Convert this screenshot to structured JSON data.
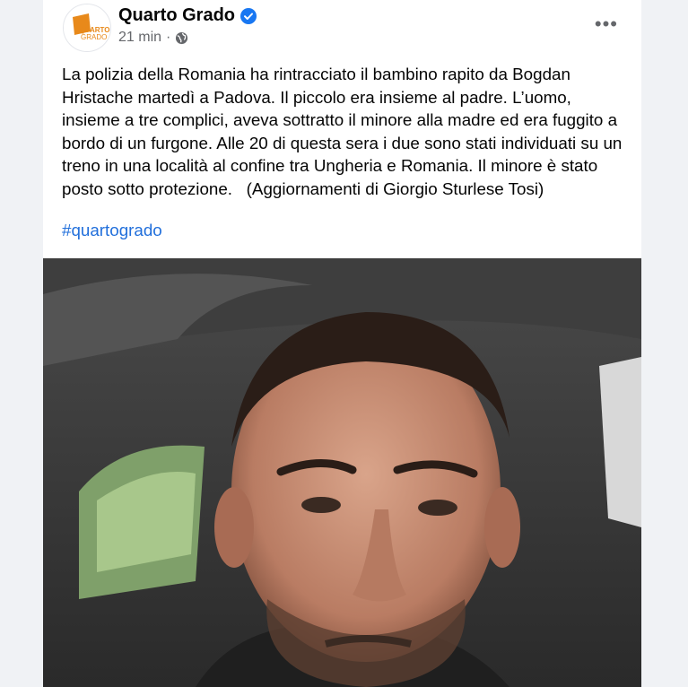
{
  "post": {
    "author": "Quarto Grado",
    "logo_text": "QUARTO GRADO",
    "timestamp": "21 min",
    "separator": "·",
    "privacy_icon": "globe-icon",
    "verified_icon": "verified-badge-icon",
    "more_icon": "more-options-icon",
    "more_label": "•••",
    "text": "La polizia della Romania ha rintracciato il bambino rapito da Bogdan Hristache martedì a Padova. Il piccolo era insieme al padre. L’uomo, insieme a tre complici, aveva sottratto il minore alla madre ed era fuggito a bordo di un furgone. Alle 20 di questa sera i due sono stati individuati su un treno in una località al confine tra Ungheria e Romania. Il minore è stato posto sotto protezione.   (Aggiornamenti di Giorgio Sturlese Tosi)",
    "hashtag": "#quartogrado"
  },
  "colors": {
    "link": "#216fdb",
    "verified": "#1877f2",
    "logo": "#e8891a"
  }
}
